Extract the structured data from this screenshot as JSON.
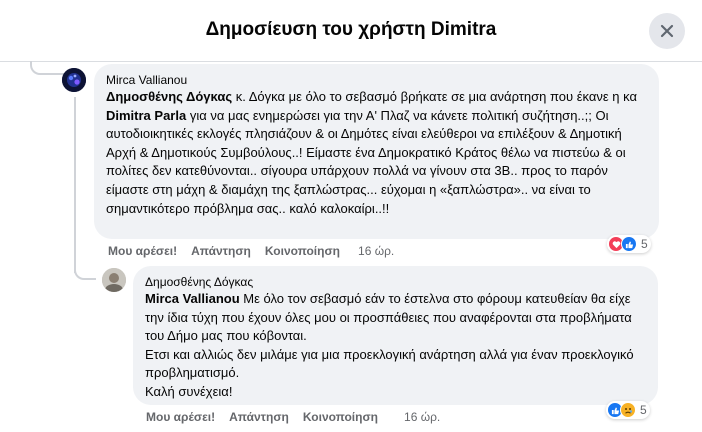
{
  "header": {
    "title": "Δημοσίευση του χρήστη Dimitra"
  },
  "comment1": {
    "author": "Mirca Vallianou",
    "mention1": "Δημοσθένης Δόγκας",
    "text1": " κ. Δόγκα με όλο το σεβασμό βρήκατε σε μια ανάρτηση που έκανε η κα ",
    "mention2": "Dimitra Parla",
    "text2": " για να μας ενημερώσει για την Α' Πλαζ να κάνετε πολιτική συζήτηση..;; Οι αυτοδιοικητικές εκλογές πλησιάζουν & οι Δημότες είναι ελεύθεροι να επιλέξουν & Δημοτική Αρχή & Δημοτικούς Συμβούλους..! Είμαστε ένα Δημοκρατικό Κράτος θέλω να πιστεύω & οι πολίτες δεν κατεθύνονται.. σίγουρα υπάρχουν πολλά να γίνουν στα 3Β.. προς το παρόν είμαστε στη μάχη & διαμάχη της ξαπλώστρας... εύχομαι η «ξαπλώστρα».. να είναι το σημαντικότερο πρόβλημα σας.. καλό καλοκαίρι..!!",
    "like_label": "Μου αρέσει!",
    "reply_label": "Απάντηση",
    "share_label": "Κοινοποίηση",
    "time": "16 ώρ.",
    "reaction_count": "5",
    "reactions": [
      "love",
      "like"
    ]
  },
  "comment2": {
    "author": "Δημοσθένης Δόγκας",
    "mention1": "Mirca Vallianou",
    "text1": " Με όλο τον σεβασμό εάν το έστελνα στο φόρουμ κατευθείαν θα είχε την ίδια τύχη που έχουν όλες μου οι προσπάθειες που αναφέρονται στα προβλήματα του Δήμο μας που κόβονται.",
    "line2": "Ετσι και αλλιώς δεν μιλάμε για μια προεκλογική ανάρτηση αλλά για έναν προεκλογικό προβληματισμό.",
    "line3": "Καλή συνέχεια!",
    "like_label": "Μου αρέσει!",
    "reply_label": "Απάντηση",
    "share_label": "Κοινοποίηση",
    "time": "16 ώρ.",
    "reaction_count": "5",
    "reactions": [
      "like",
      "sad"
    ]
  },
  "colors": {
    "like": "#1877f2",
    "love": "#f33e58",
    "sad": "#f7b125",
    "bubble": "#f0f2f5"
  }
}
